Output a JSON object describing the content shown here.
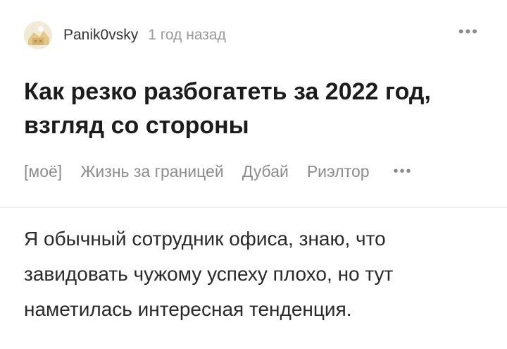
{
  "post": {
    "author": "Panik0vsky",
    "time": "1 год назад",
    "title": "Как резко разбогатеть за 2022 год, взгляд со стороны",
    "tags": [
      "[моё]",
      "Жизнь за границей",
      "Дубай",
      "Риэлтор"
    ],
    "more_symbol": "•••",
    "body": "Я обычный сотрудник офиса, знаю, что завидовать чужому успеху плохо, но тут наметилась интересная тенденция."
  }
}
